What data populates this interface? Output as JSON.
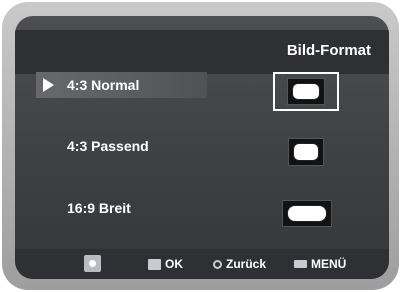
{
  "menu": {
    "title": "Bild-Format",
    "options": [
      {
        "label": "4:3 Normal",
        "selected": true
      },
      {
        "label": "4:3 Passend",
        "selected": false
      },
      {
        "label": "16:9 Breit",
        "selected": false
      }
    ]
  },
  "footer": {
    "nav_icon": "directional-pad-icon",
    "ok_icon": "enter-icon",
    "ok_label": "OK",
    "back_icon": "return-icon",
    "back_label": "Zurück",
    "menu_icon": "menu-icon",
    "menu_label": "MENÜ"
  },
  "colors": {
    "background": "#3e4044",
    "bar": "#2e3034",
    "text": "#ffffff",
    "bezel": "#a8a8a8"
  }
}
